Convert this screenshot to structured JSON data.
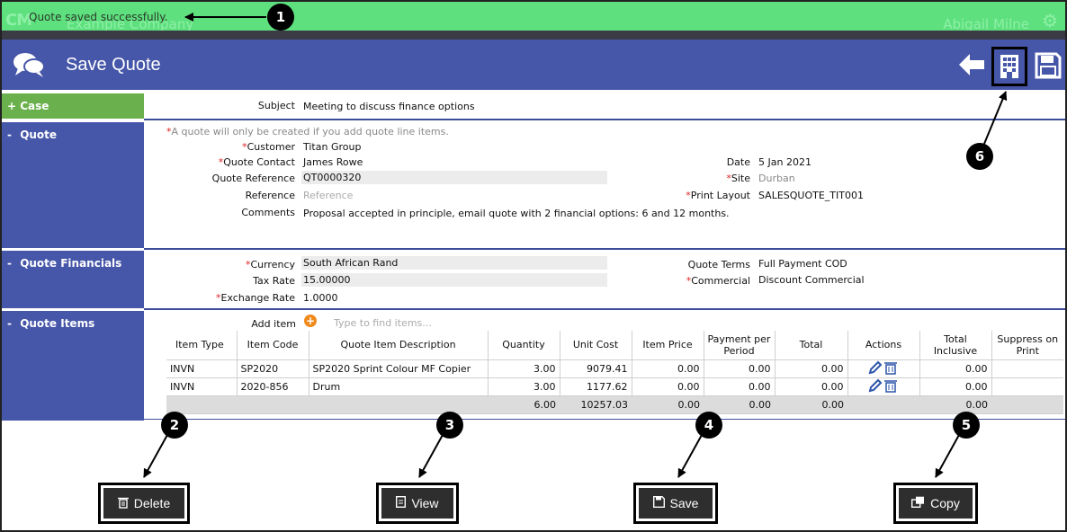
{
  "topbar": {
    "logo": "CM",
    "company": "Example Company",
    "message": "Quote saved successfully.",
    "user": "Abigail Milne",
    "gear_icon": "gear-icon"
  },
  "header": {
    "title": "Save Quote",
    "chat_icon": "chat-bubbles-icon",
    "back_icon": "arrow-left-icon",
    "building_icon": "building-icon",
    "save_icon": "floppy-disk-icon",
    "color": "#4656a8"
  },
  "sections": {
    "case": {
      "label": "Case",
      "sign": "+"
    },
    "quote": {
      "label": "Quote",
      "sign": "-"
    },
    "financials": {
      "label": "Quote Financials",
      "sign": "-"
    },
    "items": {
      "label": "Quote Items",
      "sign": "-"
    }
  },
  "case_fields": {
    "subject_label": "Subject",
    "subject_value": "Meeting to discuss finance options"
  },
  "quote": {
    "note": "A quote will only be created if you add quote line items.",
    "customer_label": "Customer",
    "customer_value": "Titan Group",
    "contact_label": "Quote Contact",
    "contact_value": "James Rowe",
    "qref_label": "Quote Reference",
    "qref_value": "QT0000320",
    "ref_label": "Reference",
    "ref_placeholder": "Reference",
    "comments_label": "Comments",
    "comments_value": "Proposal accepted in principle, email quote with 2 financial options: 6 and 12 months.",
    "date_label": "Date",
    "date_value": "5 Jan 2021",
    "site_label": "Site",
    "site_value": "Durban",
    "layout_label": "Print Layout",
    "layout_value": "SALESQUOTE_TIT001"
  },
  "financials": {
    "currency_label": "Currency",
    "currency_value": "South African Rand",
    "tax_label": "Tax Rate",
    "tax_value": "15.00000",
    "exchange_label": "Exchange Rate",
    "exchange_value": "1.0000",
    "terms_label": "Quote Terms",
    "terms_value": "Full Payment COD",
    "commercial_label": "Commercial",
    "commercial_value": "Discount Commercial"
  },
  "items": {
    "add_label": "Add item",
    "search_placeholder": "Type to find items...",
    "columns": [
      "Item Type",
      "Item Code",
      "Quote Item Description",
      "Quantity",
      "Unit Cost",
      "Item Price",
      "Payment per Period",
      "Total",
      "Actions",
      "Total Inclusive",
      "Suppress on Print"
    ],
    "rows": [
      {
        "type": "INVN",
        "code": "SP2020",
        "desc": "SP2020 Sprint Colour MF Copier",
        "qty": "3.00",
        "unit": "9079.41",
        "price": "0.00",
        "ppp": "0.00",
        "total": "0.00",
        "inclusive": "0.00"
      },
      {
        "type": "INVN",
        "code": "2020-856",
        "desc": "Drum",
        "qty": "3.00",
        "unit": "1177.62",
        "price": "0.00",
        "ppp": "0.00",
        "total": "0.00",
        "inclusive": "0.00"
      }
    ],
    "totals": {
      "qty": "6.00",
      "unit": "10257.03",
      "price": "0.00",
      "ppp": "0.00",
      "total": "0.00",
      "inclusive": "0.00"
    }
  },
  "buttons": {
    "delete": "Delete",
    "view": "View",
    "save": "Save",
    "copy": "Copy"
  },
  "callouts": [
    "1",
    "2",
    "3",
    "4",
    "5",
    "6"
  ]
}
